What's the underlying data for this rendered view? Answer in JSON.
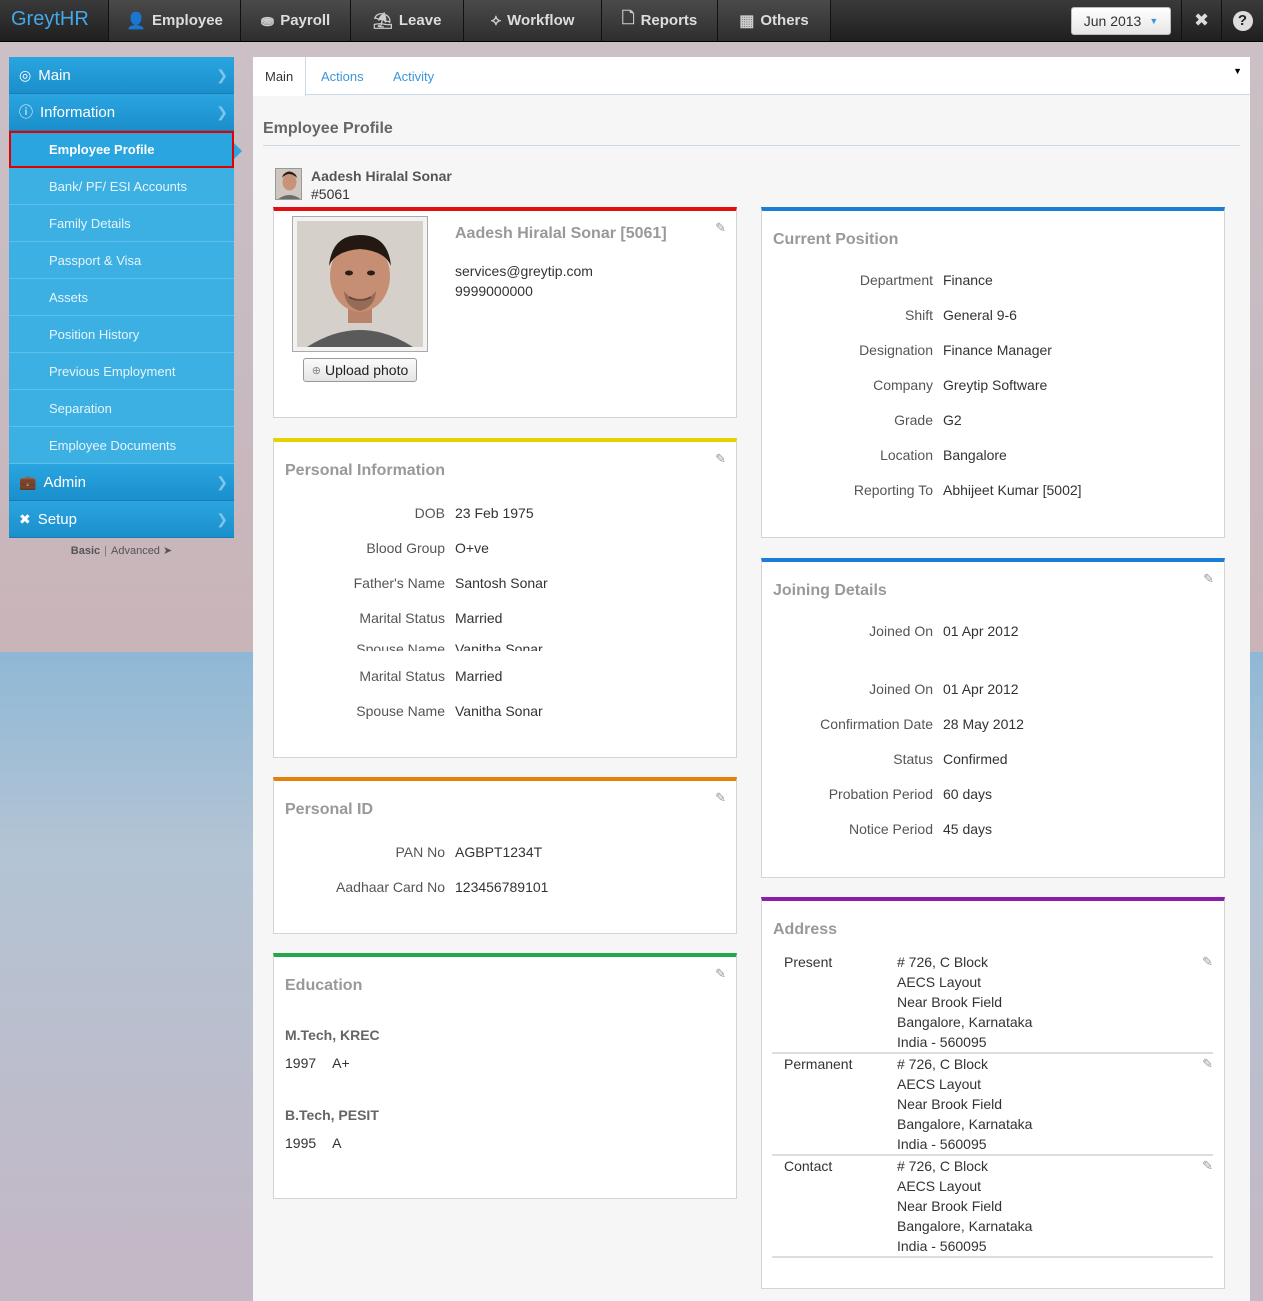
{
  "app": {
    "logo": "GreytHR"
  },
  "topnav": [
    {
      "label": "Employee",
      "icon": "person-icon"
    },
    {
      "label": "Payroll",
      "icon": "coins-icon"
    },
    {
      "label": "Leave",
      "icon": "beach-icon"
    },
    {
      "label": "Workflow",
      "icon": "workflow-icon"
    },
    {
      "label": "Reports",
      "icon": "reports-icon"
    },
    {
      "label": "Others",
      "icon": "grid-icon"
    }
  ],
  "period": {
    "label": "Jun 2013"
  },
  "sidebar": {
    "main": "Main",
    "information": "Information",
    "items": [
      "Employee Profile",
      "Bank/ PF/ ESI Accounts",
      "Family Details",
      "Passport & Visa",
      "Assets",
      "Position History",
      "Previous Employment",
      "Separation",
      "Employee Documents"
    ],
    "admin": "Admin",
    "setup": "Setup",
    "footer": {
      "basic": "Basic",
      "sep": "|",
      "advanced": "Advanced"
    }
  },
  "tabs": [
    "Main",
    "Actions",
    "Activity"
  ],
  "page": {
    "title": "Employee Profile"
  },
  "employee": {
    "name": "Aadesh Hiralal Sonar",
    "id": "#5061",
    "full_title": "Aadesh Hiralal Sonar [5061]",
    "email": "services@greytip.com",
    "phone": "9999000000",
    "upload_label": "Upload photo"
  },
  "personal_info": {
    "title": "Personal Information",
    "rows": [
      {
        "label": "DOB",
        "value": "23 Feb 1975"
      },
      {
        "label": "Blood Group",
        "value": "O+ve"
      },
      {
        "label": "Father's Name",
        "value": "Santosh Sonar"
      },
      {
        "label": "Marital Status",
        "value": "Married"
      },
      {
        "label": "Spouse Name",
        "value": "Vanitha Sonar"
      },
      {
        "label": "Marital Status",
        "value": "Married"
      },
      {
        "label": "Spouse Name",
        "value": "Vanitha Sonar"
      }
    ]
  },
  "personal_id": {
    "title": "Personal ID",
    "rows": [
      {
        "label": "PAN No",
        "value": "AGBPT1234T"
      },
      {
        "label": "Aadhaar Card No",
        "value": "123456789101"
      }
    ]
  },
  "education": {
    "title": "Education",
    "entries": [
      {
        "degree": "M.Tech, KREC",
        "year": "1997",
        "grade": "A+"
      },
      {
        "degree": "B.Tech, PESIT",
        "year": "1995",
        "grade": "A"
      }
    ]
  },
  "current_position": {
    "title": "Current Position",
    "rows": [
      {
        "label": "Department",
        "value": "Finance"
      },
      {
        "label": "Shift",
        "value": "General 9-6"
      },
      {
        "label": "Designation",
        "value": "Finance Manager"
      },
      {
        "label": "Company",
        "value": "Greytip Software"
      },
      {
        "label": "Grade",
        "value": "G2"
      },
      {
        "label": "Location",
        "value": "Bangalore"
      },
      {
        "label": "Reporting To",
        "value": "Abhijeet Kumar [5002]"
      }
    ]
  },
  "joining": {
    "title": "Joining Details",
    "rows": [
      {
        "label": "Joined On",
        "value": "01 Apr 2012"
      },
      {
        "label": "Joined On",
        "value": "01 Apr 2012"
      },
      {
        "label": "Confirmation Date",
        "value": "28 May 2012"
      },
      {
        "label": "Status",
        "value": "Confirmed"
      },
      {
        "label": "Probation Period",
        "value": "60 days"
      },
      {
        "label": "Notice Period",
        "value": "45 days"
      }
    ]
  },
  "address": {
    "title": "Address",
    "entries": [
      {
        "label": "Present",
        "lines": [
          "# 726, C Block",
          "AECS Layout",
          "Near Brook Field",
          "Bangalore, Karnataka",
          "India - 560095"
        ]
      },
      {
        "label": "Permanent",
        "lines": [
          "# 726, C Block",
          "AECS Layout",
          "Near Brook Field",
          "Bangalore, Karnataka",
          "India - 560095"
        ]
      },
      {
        "label": "Contact",
        "lines": [
          "# 726, C Block",
          "AECS Layout",
          "Near Brook Field",
          "Bangalore, Karnataka",
          "India - 560095"
        ]
      }
    ]
  },
  "colors": {
    "accent": "#2aa5e0",
    "profile_card": "#e01010",
    "personal_info_card": "#e6d200",
    "personal_id_card": "#e5820c",
    "education_card": "#22a84a",
    "position_card": "#1a7fd4",
    "joining_card": "#1a7fd4",
    "address_card": "#8a1ea8"
  }
}
